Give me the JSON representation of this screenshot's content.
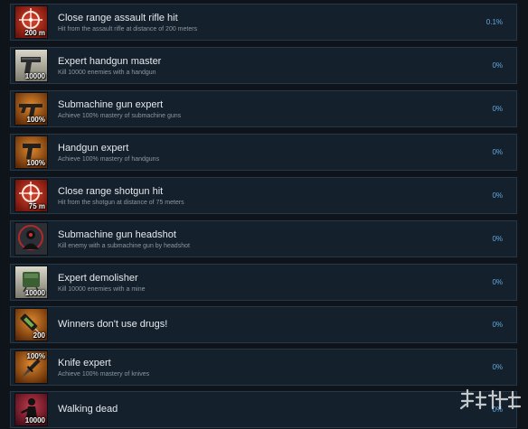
{
  "achievements": [
    {
      "title": "Close range assault rifle hit",
      "description": "Hit from the assault rifle at distance of 200 meters",
      "percent": "0.1%",
      "badge": "200 m",
      "icon": "crosshair-icon",
      "color": "#a32718"
    },
    {
      "title": "Expert handgun master",
      "description": "Kill 10000 enemies with a handgun",
      "percent": "0%",
      "badge": "10000",
      "icon": "handgun-icon",
      "color": "#b9b6a8"
    },
    {
      "title": "Submachine gun expert",
      "description": "Achieve 100% mastery of submachine guns",
      "percent": "0%",
      "badge": "100%",
      "icon": "submachine-gun-icon",
      "color": "#b45a12"
    },
    {
      "title": "Handgun expert",
      "description": "Achieve 100% mastery of handguns",
      "percent": "0%",
      "badge": "100%",
      "icon": "handgun-icon",
      "color": "#b45a12"
    },
    {
      "title": "Close range shotgun hit",
      "description": "Hit from the shotgun at distance of 75 meters",
      "percent": "0%",
      "badge": "75 m",
      "icon": "crosshair-icon",
      "color": "#a32718"
    },
    {
      "title": "Submachine gun headshot",
      "description": "Kill enemy with a submachine gun by headshot",
      "percent": "0%",
      "badge": "",
      "icon": "headshot-target-icon",
      "color": "#3a3f46"
    },
    {
      "title": "Expert demolisher",
      "description": "Kill 10000 enemies with a mine",
      "percent": "0%",
      "badge": "10000",
      "icon": "mine-icon",
      "color": "#b9b6a8"
    },
    {
      "title": "Winners don't use drugs!",
      "description": "",
      "percent": "0%",
      "badge": "200",
      "icon": "syringe-icon",
      "color": "#b45a12"
    },
    {
      "title": "Knife expert",
      "description": "Achieve 100% mastery of knives",
      "percent": "0%",
      "badge": "100%",
      "icon": "knife-icon",
      "color": "#b45a12"
    },
    {
      "title": "Walking dead",
      "description": "",
      "percent": "0%",
      "badge": "10000",
      "icon": "zombie-icon",
      "color": "#8f1f2c"
    }
  ]
}
